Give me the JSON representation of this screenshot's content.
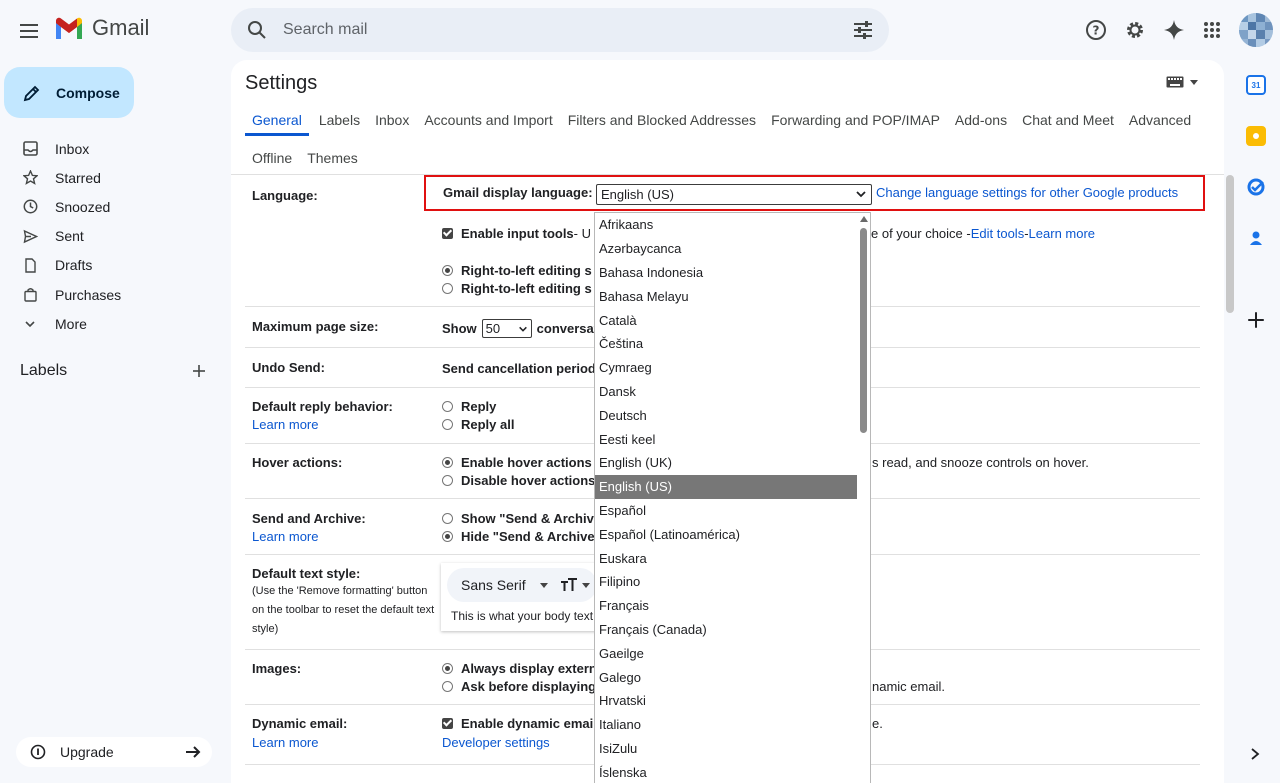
{
  "app": {
    "name": "Gmail"
  },
  "search": {
    "placeholder": "Search mail"
  },
  "compose": {
    "label": "Compose"
  },
  "nav": [
    {
      "label": "Inbox",
      "icon": "inbox-icon"
    },
    {
      "label": "Starred",
      "icon": "star-icon"
    },
    {
      "label": "Snoozed",
      "icon": "clock-icon"
    },
    {
      "label": "Sent",
      "icon": "send-icon"
    },
    {
      "label": "Drafts",
      "icon": "draft-icon"
    },
    {
      "label": "Purchases",
      "icon": "bag-icon"
    },
    {
      "label": "More",
      "icon": "chevron-down-icon"
    }
  ],
  "labels": {
    "heading": "Labels"
  },
  "upgrade": {
    "label": "Upgrade"
  },
  "settings": {
    "title": "Settings",
    "tabs_row1": [
      "General",
      "Labels",
      "Inbox",
      "Accounts and Import",
      "Filters and Blocked Addresses",
      "Forwarding and POP/IMAP",
      "Add-ons",
      "Chat and Meet",
      "Advanced"
    ],
    "tabs_row2": [
      "Offline",
      "Themes"
    ],
    "active_tab": "General"
  },
  "language": {
    "label": "Language:",
    "display_label": "Gmail display language:",
    "selected": "English (US)",
    "other_products_link": "Change language settings for other Google products",
    "input_tools_bold": "Enable input tools",
    "input_tools_rest": " - U",
    "input_tools_tail": "e of your choice - ",
    "edit_tools": "Edit tools",
    "dash": " - ",
    "learn_more": "Learn more",
    "rtl_on": "Right-to-left editing s",
    "rtl_off": "Right-to-left editing s"
  },
  "page_size": {
    "label": "Maximum page size:",
    "show": "Show",
    "value": "50",
    "rest": "conversat"
  },
  "undo_send": {
    "label": "Undo Send:",
    "text": "Send cancellation period"
  },
  "reply": {
    "label": "Default reply behavior:",
    "learn_more": "Learn more",
    "opt1": "Reply",
    "opt2": "Reply all"
  },
  "hover": {
    "label": "Hover actions:",
    "opt1": "Enable hover actions",
    "opt1_tail": "s read, and snooze controls on hover.",
    "opt2": "Disable hover actions"
  },
  "send_archive": {
    "label": "Send and Archive:",
    "learn_more": "Learn more",
    "opt1": "Show \"Send & Archive",
    "opt2": "Hide \"Send & Archive"
  },
  "text_style": {
    "label": "Default text style:",
    "sub": "(Use the 'Remove formatting' button on the toolbar to reset the default text style)",
    "font": "Sans Serif",
    "body": "This is what your body text"
  },
  "images": {
    "label": "Images:",
    "opt1": "Always display extern",
    "opt2": "Ask before displaying",
    "opt2_tail": "namic email."
  },
  "dynamic": {
    "label": "Dynamic email:",
    "learn_more": "Learn more",
    "opt1": "Enable dynamic emai",
    "opt1_tail": "e.",
    "dev": "Developer settings"
  },
  "dropdown": {
    "items": [
      "Afrikaans",
      "Azərbaycanca",
      "Bahasa Indonesia",
      "Bahasa Melayu",
      "Català",
      "Čeština",
      "Cymraeg",
      "Dansk",
      "Deutsch",
      "Eesti keel",
      "English (UK)",
      "English (US)",
      "Español",
      "Español (Latinoamérica)",
      "Euskara",
      "Filipino",
      "Français",
      "Français (Canada)",
      "Gaeilge",
      "Galego",
      "Hrvatski",
      "Italiano",
      "IsiZulu",
      "Íslenska"
    ],
    "selected_index": 11
  },
  "colors": {
    "accent": "#0b57d0",
    "compose_bg": "#c2e7ff",
    "highlight": "#e01010"
  }
}
